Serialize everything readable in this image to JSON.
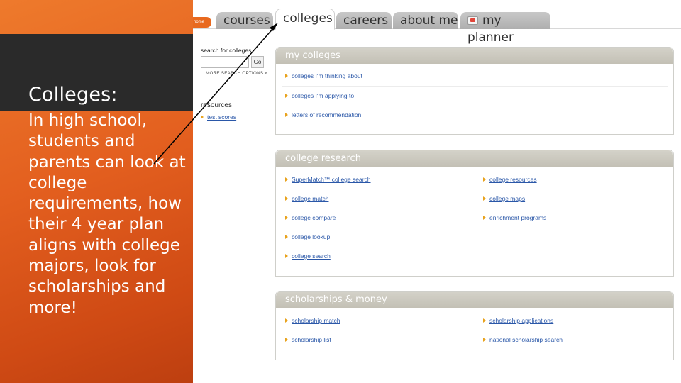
{
  "slide": {
    "title": "Colleges:",
    "body": "In high school, students and parents can look at college requirements, how their 4 year plan aligns with college majors, look for scholarships and more!"
  },
  "tabs": {
    "home": "home",
    "items": [
      "courses",
      "colleges",
      "careers",
      "about me",
      "my planner"
    ]
  },
  "search": {
    "label": "search for colleges",
    "placeholder": "",
    "go": "Go",
    "more_options": "MORE SEARCH OPTIONS »"
  },
  "resources": {
    "heading": "resources",
    "links": [
      "test scores"
    ]
  },
  "my_colleges": {
    "title": "my colleges",
    "links": [
      "colleges I'm thinking about",
      "colleges I'm applying to",
      "letters of recommendation"
    ]
  },
  "college_research": {
    "title": "college research",
    "left_links": [
      "SuperMatch™ college search",
      "college match",
      "college compare",
      "college lookup",
      "college search"
    ],
    "right_links": [
      "college resources",
      "college maps",
      "enrichment programs"
    ]
  },
  "scholarships": {
    "title": "scholarships & money",
    "left_links": [
      "scholarship match",
      "scholarship list"
    ],
    "right_links": [
      "scholarship applications",
      "national scholarship search"
    ]
  },
  "colors": {
    "accent_orange": "#e8691f",
    "link_blue": "#2a57a8",
    "bullet_gold": "#e8a21c",
    "box_header": "#c8c6bc"
  },
  "icons": [
    "bullet-arrow-icon",
    "planner-icon",
    "annotation-arrow"
  ]
}
